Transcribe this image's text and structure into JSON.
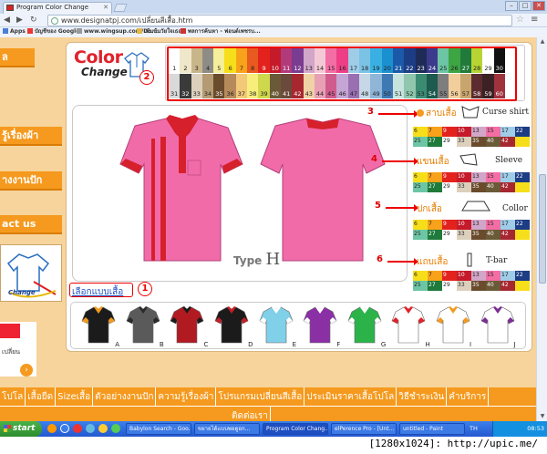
{
  "browser": {
    "tab_title": "Program Color Change",
    "url": "www.designatpj.com/เปลี่ยนสีเสื้อ.htm",
    "bookmarks": [
      "Apps",
      "บัญชีของ Google",
      "www.wingsup.com/Do...",
      "เข้มข้นวัยใจเธอ",
      "พลการค้นหา - ฟอนต์เพชรบ..."
    ]
  },
  "sidebar": {
    "items": [
      "ล",
      "รู้เรื่องผ้า",
      "างงานปัก",
      "act us"
    ],
    "card_text": "Change",
    "card2_text": "เปลี่ยน"
  },
  "logo": {
    "line1": "Color",
    "line2": "Change"
  },
  "palette": {
    "row1": [
      {
        "n": "1",
        "c": "#ffffff"
      },
      {
        "n": "2",
        "c": "#efe7c9"
      },
      {
        "n": "3",
        "c": "#c9b58a"
      },
      {
        "n": "4",
        "c": "#8e8c86"
      },
      {
        "n": "5",
        "c": "#f5ee9a"
      },
      {
        "n": "6",
        "c": "#f6df1a"
      },
      {
        "n": "7",
        "c": "#f7a21a"
      },
      {
        "n": "8",
        "c": "#e85a20"
      },
      {
        "n": "9",
        "c": "#e4221d"
      },
      {
        "n": "10",
        "c": "#c51a2a"
      },
      {
        "n": "11",
        "c": "#b13a7b"
      },
      {
        "n": "12",
        "c": "#7a3c91"
      },
      {
        "n": "13",
        "c": "#d2a6c8"
      },
      {
        "n": "14",
        "c": "#f4c9d6"
      },
      {
        "n": "15",
        "c": "#f36ea4"
      },
      {
        "n": "16",
        "c": "#ee3f86"
      },
      {
        "n": "17",
        "c": "#9fcde8"
      },
      {
        "n": "18",
        "c": "#7bc3e4"
      },
      {
        "n": "19",
        "c": "#3ab0e2"
      },
      {
        "n": "20",
        "c": "#1b90d0"
      },
      {
        "n": "21",
        "c": "#1a5aa8"
      },
      {
        "n": "22",
        "c": "#1c3c84"
      },
      {
        "n": "23",
        "c": "#1e2b56"
      },
      {
        "n": "24",
        "c": "#3b3b8d"
      },
      {
        "n": "25",
        "c": "#6cc5a4"
      },
      {
        "n": "26",
        "c": "#3da542"
      },
      {
        "n": "27",
        "c": "#1f7a3b"
      },
      {
        "n": "28",
        "c": "#b8d432"
      },
      {
        "n": "29",
        "c": "#ffffff"
      },
      {
        "n": "30",
        "c": "#111111"
      }
    ],
    "row2": [
      {
        "n": "31",
        "c": "#d9d9d9"
      },
      {
        "n": "32",
        "c": "#3a3a3a"
      },
      {
        "n": "33",
        "c": "#dcd0bd"
      },
      {
        "n": "34",
        "c": "#b49b73"
      },
      {
        "n": "35",
        "c": "#6a4b2c"
      },
      {
        "n": "36",
        "c": "#b78a5b"
      },
      {
        "n": "37",
        "c": "#f3c979"
      },
      {
        "n": "38",
        "c": "#f7ee7c"
      },
      {
        "n": "39",
        "c": "#cfd84c"
      },
      {
        "n": "40",
        "c": "#6b5a37"
      },
      {
        "n": "41",
        "c": "#6a4a3a"
      },
      {
        "n": "42",
        "c": "#a72730"
      },
      {
        "n": "43",
        "c": "#f0d2a6"
      },
      {
        "n": "44",
        "c": "#e8a0b5"
      },
      {
        "n": "45",
        "c": "#d05c8e"
      },
      {
        "n": "46",
        "c": "#c5a5d4"
      },
      {
        "n": "47",
        "c": "#9a6fb2"
      },
      {
        "n": "48",
        "c": "#c6d7e6"
      },
      {
        "n": "49",
        "c": "#8fb5d7"
      },
      {
        "n": "50",
        "c": "#3e79b4"
      },
      {
        "n": "51",
        "c": "#c7e3dd"
      },
      {
        "n": "52",
        "c": "#8fc6ad"
      },
      {
        "n": "53",
        "c": "#3b8b73"
      },
      {
        "n": "54",
        "c": "#1c5b4e"
      },
      {
        "n": "55",
        "c": "#7d7d7d"
      },
      {
        "n": "56",
        "c": "#f1ce9c"
      },
      {
        "n": "57",
        "c": "#c7a56d"
      },
      {
        "n": "58",
        "c": "#5c2b2f"
      },
      {
        "n": "59",
        "c": "#3b2124"
      },
      {
        "n": "60",
        "c": "#a0323d"
      }
    ]
  },
  "preview": {
    "type_label": "Type",
    "type_letter": "H"
  },
  "parts": [
    {
      "num": "3",
      "th": "สาบเสื้อ",
      "en": "Curse shirt"
    },
    {
      "num": "4",
      "th": "แขนเสื้อ",
      "en": "Sleeve"
    },
    {
      "num": "5",
      "th": "ปกเสื้อ",
      "en": "Collor"
    },
    {
      "num": "6",
      "th": "แถบเสื้อ",
      "en": "T-bar"
    }
  ],
  "mini_palette": {
    "numbers": [
      "6",
      "7",
      "9",
      "10",
      "13",
      "15",
      "17",
      "22",
      "25",
      "27",
      "29",
      "33",
      "35",
      "40",
      "42"
    ],
    "colors": [
      "#f6df1a",
      "#f7a21a",
      "#e4221d",
      "#c51a2a",
      "#d2a6c8",
      "#f36ea4",
      "#9fcde8",
      "#1c3c84",
      "#6cc5a4",
      "#1f7a3b",
      "#ffffff",
      "#dcd0bd",
      "#6a4b2c",
      "#6b5a37",
      "#a72730",
      "#f6df1a"
    ]
  },
  "marker_numbers": {
    "palette": "2",
    "type_selector": "1"
  },
  "type_selector": {
    "label": "เลือกแบบเสื้อ",
    "items": [
      {
        "letter": "A",
        "c1": "#1b1b1b",
        "c2": "#f39a1e"
      },
      {
        "letter": "B",
        "c1": "#5a5a5a",
        "c2": "#2a2a2a"
      },
      {
        "letter": "C",
        "c1": "#b21a22",
        "c2": "#1b1b1b"
      },
      {
        "letter": "D",
        "c1": "#1b1b1b",
        "c2": "#c41e26"
      },
      {
        "letter": "E",
        "c1": "#7fd0e8",
        "c2": "#ffffff"
      },
      {
        "letter": "F",
        "c1": "#8b2fa5",
        "c2": "#ffffff"
      },
      {
        "letter": "G",
        "c1": "#2bb34a",
        "c2": "#ffffff"
      },
      {
        "letter": "H",
        "c1": "#ffffff",
        "c2": "#e0222a"
      },
      {
        "letter": "I",
        "c1": "#ffffff",
        "c2": "#f39a1e"
      },
      {
        "letter": "J",
        "c1": "#ffffff",
        "c2": "#7b2d93"
      }
    ]
  },
  "bottom_menu": {
    "row1": [
      "โปโล",
      "เสื้อยืด",
      "Sizeเสื้อ",
      "ตัวอย่างงานปัก",
      "ความรู้เรื่องผ้า",
      "โปรแกรมเปลี่ยนสีเสื้อ",
      "ประเมินราคาเสื้อโปโล",
      "วิธีชำระเงิน",
      "คำบริการ"
    ],
    "row2": [
      "ติดต่อเรา"
    ]
  },
  "taskbar": {
    "start": "start",
    "tasks": [
      "Babylon Search - Goo...",
      "ขยายได้แบบพอดูอก...",
      "Program Color Chang...",
      "elPerence Pro - [Unt...",
      "untitled - Paint"
    ],
    "clock": "08:53",
    "lang": "TH"
  },
  "watermark": "[1280x1024]: http://upic.me/",
  "colors": {
    "accent_orange": "#f59a1e",
    "page_bg": "#f7d49b",
    "marker_red": "#e00000",
    "shirt_pink": "#f26ba9",
    "shirt_red": "#d6202c"
  }
}
